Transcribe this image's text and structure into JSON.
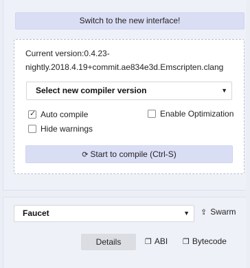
{
  "banner": {
    "label": "Switch to the new interface!"
  },
  "compiler": {
    "current_version": "Current version:0.4.23-nightly.2018.4.19+commit.ae834e3d.Emscripten.clang",
    "select_placeholder": "Select new compiler version",
    "auto_compile": {
      "label": "Auto compile",
      "checked": true
    },
    "enable_optimization": {
      "label": "Enable Optimization",
      "checked": false
    },
    "hide_warnings": {
      "label": "Hide warnings",
      "checked": false
    },
    "compile_button": "Start to compile (Ctrl-S)"
  },
  "contract": {
    "selected": "Faucet",
    "swarm_label": "Swarm",
    "details_label": "Details",
    "abi_label": "ABI",
    "bytecode_label": "Bytecode"
  },
  "icons": {
    "caret": "caret-down-icon",
    "refresh": "refresh-icon",
    "upload": "upload-icon",
    "clipboard": "clipboard-icon"
  }
}
